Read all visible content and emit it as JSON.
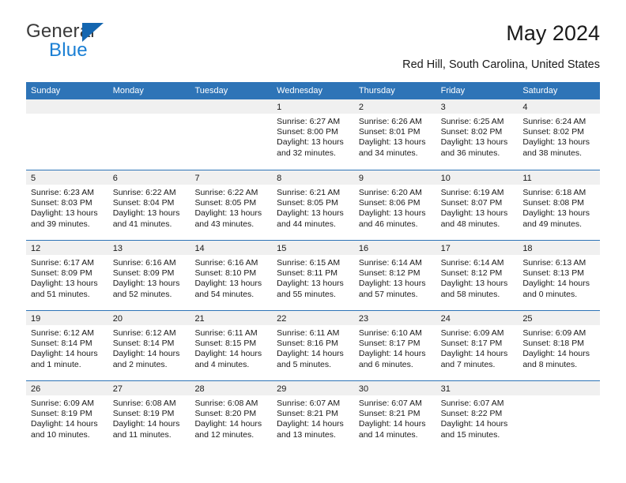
{
  "brand": {
    "name_top": "General",
    "name_bottom": "Blue",
    "accent_color": "#1a7fd4",
    "triangle_color": "#1466b0"
  },
  "header": {
    "title": "May 2024",
    "subtitle": "Red Hill, South Carolina, United States",
    "header_bg_color": "#2e74b7"
  },
  "calendar": {
    "weekdays": [
      "Sunday",
      "Monday",
      "Tuesday",
      "Wednesday",
      "Thursday",
      "Friday",
      "Saturday"
    ],
    "weeks": [
      [
        {
          "day": "",
          "empty": true
        },
        {
          "day": "",
          "empty": true
        },
        {
          "day": "",
          "empty": true
        },
        {
          "day": "1",
          "sunrise": "Sunrise: 6:27 AM",
          "sunset": "Sunset: 8:00 PM",
          "daylight_1": "Daylight: 13 hours",
          "daylight_2": "and 32 minutes."
        },
        {
          "day": "2",
          "sunrise": "Sunrise: 6:26 AM",
          "sunset": "Sunset: 8:01 PM",
          "daylight_1": "Daylight: 13 hours",
          "daylight_2": "and 34 minutes."
        },
        {
          "day": "3",
          "sunrise": "Sunrise: 6:25 AM",
          "sunset": "Sunset: 8:02 PM",
          "daylight_1": "Daylight: 13 hours",
          "daylight_2": "and 36 minutes."
        },
        {
          "day": "4",
          "sunrise": "Sunrise: 6:24 AM",
          "sunset": "Sunset: 8:02 PM",
          "daylight_1": "Daylight: 13 hours",
          "daylight_2": "and 38 minutes."
        }
      ],
      [
        {
          "day": "5",
          "sunrise": "Sunrise: 6:23 AM",
          "sunset": "Sunset: 8:03 PM",
          "daylight_1": "Daylight: 13 hours",
          "daylight_2": "and 39 minutes."
        },
        {
          "day": "6",
          "sunrise": "Sunrise: 6:22 AM",
          "sunset": "Sunset: 8:04 PM",
          "daylight_1": "Daylight: 13 hours",
          "daylight_2": "and 41 minutes."
        },
        {
          "day": "7",
          "sunrise": "Sunrise: 6:22 AM",
          "sunset": "Sunset: 8:05 PM",
          "daylight_1": "Daylight: 13 hours",
          "daylight_2": "and 43 minutes."
        },
        {
          "day": "8",
          "sunrise": "Sunrise: 6:21 AM",
          "sunset": "Sunset: 8:05 PM",
          "daylight_1": "Daylight: 13 hours",
          "daylight_2": "and 44 minutes."
        },
        {
          "day": "9",
          "sunrise": "Sunrise: 6:20 AM",
          "sunset": "Sunset: 8:06 PM",
          "daylight_1": "Daylight: 13 hours",
          "daylight_2": "and 46 minutes."
        },
        {
          "day": "10",
          "sunrise": "Sunrise: 6:19 AM",
          "sunset": "Sunset: 8:07 PM",
          "daylight_1": "Daylight: 13 hours",
          "daylight_2": "and 48 minutes."
        },
        {
          "day": "11",
          "sunrise": "Sunrise: 6:18 AM",
          "sunset": "Sunset: 8:08 PM",
          "daylight_1": "Daylight: 13 hours",
          "daylight_2": "and 49 minutes."
        }
      ],
      [
        {
          "day": "12",
          "sunrise": "Sunrise: 6:17 AM",
          "sunset": "Sunset: 8:09 PM",
          "daylight_1": "Daylight: 13 hours",
          "daylight_2": "and 51 minutes."
        },
        {
          "day": "13",
          "sunrise": "Sunrise: 6:16 AM",
          "sunset": "Sunset: 8:09 PM",
          "daylight_1": "Daylight: 13 hours",
          "daylight_2": "and 52 minutes."
        },
        {
          "day": "14",
          "sunrise": "Sunrise: 6:16 AM",
          "sunset": "Sunset: 8:10 PM",
          "daylight_1": "Daylight: 13 hours",
          "daylight_2": "and 54 minutes."
        },
        {
          "day": "15",
          "sunrise": "Sunrise: 6:15 AM",
          "sunset": "Sunset: 8:11 PM",
          "daylight_1": "Daylight: 13 hours",
          "daylight_2": "and 55 minutes."
        },
        {
          "day": "16",
          "sunrise": "Sunrise: 6:14 AM",
          "sunset": "Sunset: 8:12 PM",
          "daylight_1": "Daylight: 13 hours",
          "daylight_2": "and 57 minutes."
        },
        {
          "day": "17",
          "sunrise": "Sunrise: 6:14 AM",
          "sunset": "Sunset: 8:12 PM",
          "daylight_1": "Daylight: 13 hours",
          "daylight_2": "and 58 minutes."
        },
        {
          "day": "18",
          "sunrise": "Sunrise: 6:13 AM",
          "sunset": "Sunset: 8:13 PM",
          "daylight_1": "Daylight: 14 hours",
          "daylight_2": "and 0 minutes."
        }
      ],
      [
        {
          "day": "19",
          "sunrise": "Sunrise: 6:12 AM",
          "sunset": "Sunset: 8:14 PM",
          "daylight_1": "Daylight: 14 hours",
          "daylight_2": "and 1 minute."
        },
        {
          "day": "20",
          "sunrise": "Sunrise: 6:12 AM",
          "sunset": "Sunset: 8:14 PM",
          "daylight_1": "Daylight: 14 hours",
          "daylight_2": "and 2 minutes."
        },
        {
          "day": "21",
          "sunrise": "Sunrise: 6:11 AM",
          "sunset": "Sunset: 8:15 PM",
          "daylight_1": "Daylight: 14 hours",
          "daylight_2": "and 4 minutes."
        },
        {
          "day": "22",
          "sunrise": "Sunrise: 6:11 AM",
          "sunset": "Sunset: 8:16 PM",
          "daylight_1": "Daylight: 14 hours",
          "daylight_2": "and 5 minutes."
        },
        {
          "day": "23",
          "sunrise": "Sunrise: 6:10 AM",
          "sunset": "Sunset: 8:17 PM",
          "daylight_1": "Daylight: 14 hours",
          "daylight_2": "and 6 minutes."
        },
        {
          "day": "24",
          "sunrise": "Sunrise: 6:09 AM",
          "sunset": "Sunset: 8:17 PM",
          "daylight_1": "Daylight: 14 hours",
          "daylight_2": "and 7 minutes."
        },
        {
          "day": "25",
          "sunrise": "Sunrise: 6:09 AM",
          "sunset": "Sunset: 8:18 PM",
          "daylight_1": "Daylight: 14 hours",
          "daylight_2": "and 8 minutes."
        }
      ],
      [
        {
          "day": "26",
          "sunrise": "Sunrise: 6:09 AM",
          "sunset": "Sunset: 8:19 PM",
          "daylight_1": "Daylight: 14 hours",
          "daylight_2": "and 10 minutes."
        },
        {
          "day": "27",
          "sunrise": "Sunrise: 6:08 AM",
          "sunset": "Sunset: 8:19 PM",
          "daylight_1": "Daylight: 14 hours",
          "daylight_2": "and 11 minutes."
        },
        {
          "day": "28",
          "sunrise": "Sunrise: 6:08 AM",
          "sunset": "Sunset: 8:20 PM",
          "daylight_1": "Daylight: 14 hours",
          "daylight_2": "and 12 minutes."
        },
        {
          "day": "29",
          "sunrise": "Sunrise: 6:07 AM",
          "sunset": "Sunset: 8:21 PM",
          "daylight_1": "Daylight: 14 hours",
          "daylight_2": "and 13 minutes."
        },
        {
          "day": "30",
          "sunrise": "Sunrise: 6:07 AM",
          "sunset": "Sunset: 8:21 PM",
          "daylight_1": "Daylight: 14 hours",
          "daylight_2": "and 14 minutes."
        },
        {
          "day": "31",
          "sunrise": "Sunrise: 6:07 AM",
          "sunset": "Sunset: 8:22 PM",
          "daylight_1": "Daylight: 14 hours",
          "daylight_2": "and 15 minutes."
        },
        {
          "day": "",
          "empty": true
        }
      ]
    ]
  }
}
